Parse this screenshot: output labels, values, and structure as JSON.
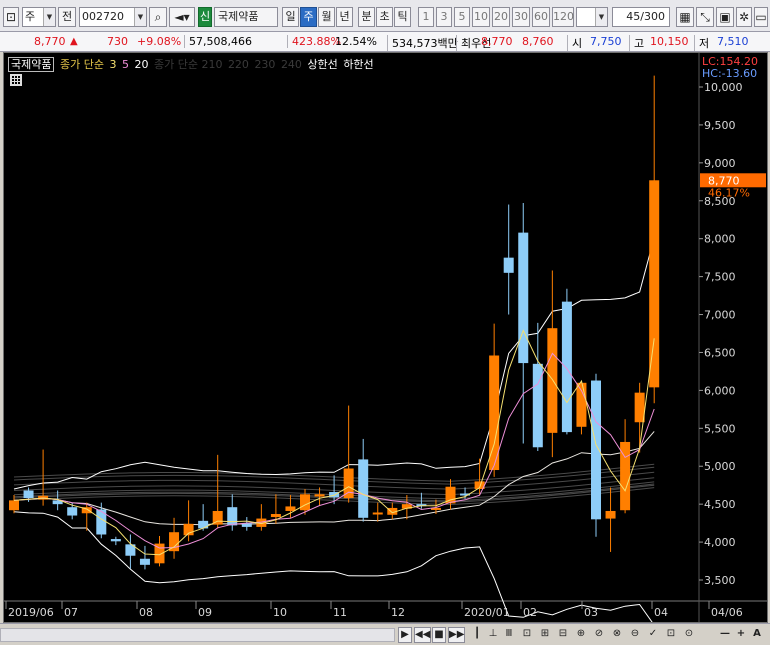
{
  "toolbar": {
    "type_label": "주",
    "price_label": "전",
    "code_value": "002720",
    "badge": "신",
    "stock_name": "국제약품",
    "periods": [
      "일",
      "주",
      "월",
      "년",
      "분",
      "초",
      "틱"
    ],
    "active_period": "주",
    "intervals": [
      "1",
      "3",
      "5",
      "10",
      "20",
      "30",
      "60",
      "120"
    ],
    "count_value": "45",
    "count_total": "/300"
  },
  "infobar": {
    "price": "8,770",
    "change_arrow": "▲",
    "change": "730",
    "change_pct": "+9.08%",
    "volume": "57,508,466",
    "volume_ratio": "423.88%",
    "turnover": "12.54%",
    "amount": "534,573백만",
    "best_ask_label": "최우선",
    "best_ask": "8,770",
    "best_bid": "8,760",
    "open_label": "시",
    "open": "7,750",
    "high_label": "고",
    "high": "10,150",
    "low_label": "저",
    "low": "7,510"
  },
  "legend": {
    "name": "국제약품",
    "label_main": "종가 단순",
    "ma3": "3",
    "ma5": "5",
    "ma20": "20",
    "label_dim": "종가 단순 210",
    "ma220": "220",
    "ma230": "230",
    "ma240": "240",
    "upper_limit": "상한선",
    "lower_limit": "하한선"
  },
  "right_labels": {
    "lc": "LC:154.20",
    "hc": "HC:-13.60",
    "current_price": "8,770",
    "current_pct": "46.17%"
  },
  "chart_data": {
    "type": "candlestick",
    "y_ticks": [
      3500,
      4000,
      4500,
      5000,
      5500,
      6000,
      6500,
      7000,
      7500,
      8000,
      8500,
      9000,
      9500,
      10000
    ],
    "ylim": [
      3200,
      10200
    ],
    "x_labels": [
      "2019/06",
      "07",
      "08",
      "09",
      "10",
      "11",
      "12",
      "2020/01",
      "02",
      "03",
      "04",
      "04/06"
    ],
    "candles": [
      {
        "o": 4420,
        "c": 4550,
        "h": 4620,
        "l": 4380
      },
      {
        "o": 4680,
        "c": 4580,
        "h": 4720,
        "l": 4530
      },
      {
        "o": 4560,
        "c": 4610,
        "h": 5220,
        "l": 4480
      },
      {
        "o": 4550,
        "c": 4500,
        "h": 4680,
        "l": 4420
      },
      {
        "o": 4460,
        "c": 4350,
        "h": 4520,
        "l": 4300
      },
      {
        "o": 4380,
        "c": 4460,
        "h": 4520,
        "l": 4150
      },
      {
        "o": 4430,
        "c": 4100,
        "h": 4520,
        "l": 4050
      },
      {
        "o": 4040,
        "c": 4010,
        "h": 4070,
        "l": 3960
      },
      {
        "o": 3970,
        "c": 3820,
        "h": 4100,
        "l": 3650
      },
      {
        "o": 3780,
        "c": 3700,
        "h": 3950,
        "l": 3640
      },
      {
        "o": 3720,
        "c": 3980,
        "h": 4080,
        "l": 3680
      },
      {
        "o": 3880,
        "c": 4130,
        "h": 4320,
        "l": 3780
      },
      {
        "o": 4090,
        "c": 4240,
        "h": 4550,
        "l": 4010
      },
      {
        "o": 4280,
        "c": 4180,
        "h": 4500,
        "l": 4150
      },
      {
        "o": 4230,
        "c": 4410,
        "h": 5150,
        "l": 4180
      },
      {
        "o": 4460,
        "c": 4220,
        "h": 4630,
        "l": 4150
      },
      {
        "o": 4250,
        "c": 4200,
        "h": 4330,
        "l": 4150
      },
      {
        "o": 4200,
        "c": 4310,
        "h": 4500,
        "l": 4150
      },
      {
        "o": 4330,
        "c": 4370,
        "h": 4630,
        "l": 4240
      },
      {
        "o": 4410,
        "c": 4470,
        "h": 4620,
        "l": 4320
      },
      {
        "o": 4420,
        "c": 4630,
        "h": 4700,
        "l": 4360
      },
      {
        "o": 4600,
        "c": 4630,
        "h": 4720,
        "l": 4480
      },
      {
        "o": 4660,
        "c": 4590,
        "h": 4880,
        "l": 4500
      },
      {
        "o": 4580,
        "c": 4970,
        "h": 5800,
        "l": 4520
      },
      {
        "o": 5090,
        "c": 4320,
        "h": 5360,
        "l": 4270
      },
      {
        "o": 4370,
        "c": 4390,
        "h": 4520,
        "l": 4270
      },
      {
        "o": 4360,
        "c": 4450,
        "h": 4520,
        "l": 4300
      },
      {
        "o": 4440,
        "c": 4500,
        "h": 4620,
        "l": 4300
      },
      {
        "o": 4500,
        "c": 4490,
        "h": 4650,
        "l": 4440
      },
      {
        "o": 4430,
        "c": 4450,
        "h": 4560,
        "l": 4370
      },
      {
        "o": 4510,
        "c": 4730,
        "h": 4830,
        "l": 4430
      },
      {
        "o": 4640,
        "c": 4620,
        "h": 4720,
        "l": 4570
      },
      {
        "o": 4700,
        "c": 4800,
        "h": 5100,
        "l": 4620
      },
      {
        "o": 4950,
        "c": 6460,
        "h": 6880,
        "l": 4860
      },
      {
        "o": 7750,
        "c": 7550,
        "h": 8450,
        "l": 7000
      },
      {
        "o": 8080,
        "c": 6360,
        "h": 8470,
        "l": 5300
      },
      {
        "o": 6350,
        "c": 5250,
        "h": 6890,
        "l": 5200
      },
      {
        "o": 5440,
        "c": 6820,
        "h": 7580,
        "l": 5120
      },
      {
        "o": 7170,
        "c": 5450,
        "h": 7340,
        "l": 5420
      },
      {
        "o": 5520,
        "c": 6100,
        "h": 6120,
        "l": 5420
      },
      {
        "o": 6130,
        "c": 4300,
        "h": 6220,
        "l": 4070
      },
      {
        "o": 4310,
        "c": 4410,
        "h": 4720,
        "l": 3870
      },
      {
        "o": 4420,
        "c": 5320,
        "h": 5620,
        "l": 4380
      },
      {
        "o": 5580,
        "c": 5970,
        "h": 6100,
        "l": 5180
      },
      {
        "o": 6040,
        "c": 8770,
        "h": 10150,
        "l": 5830
      }
    ]
  },
  "colors": {
    "up": "#ff7f00",
    "down": "#8ecdf8",
    "ma_main": "#e9e6e0",
    "ma3": "#f5e070",
    "ma5": "#ee8fd8",
    "ma20": "#ffffff",
    "axis_text": "#d8d8d8",
    "price_tag": "#ff6a00",
    "lc": "#ff4040",
    "hc": "#6a9cff"
  },
  "bottombar": {
    "buttons": [
      "▶",
      "◀◀",
      "■",
      "▶▶"
    ],
    "tools": [
      "┃",
      "⊥",
      "Ⅲ",
      "⊡",
      "⊞",
      "⊟",
      "⊕",
      "⊘",
      "⊗",
      "⊖",
      "✓",
      "⊡",
      "⊙",
      "—",
      "+",
      "A"
    ]
  }
}
